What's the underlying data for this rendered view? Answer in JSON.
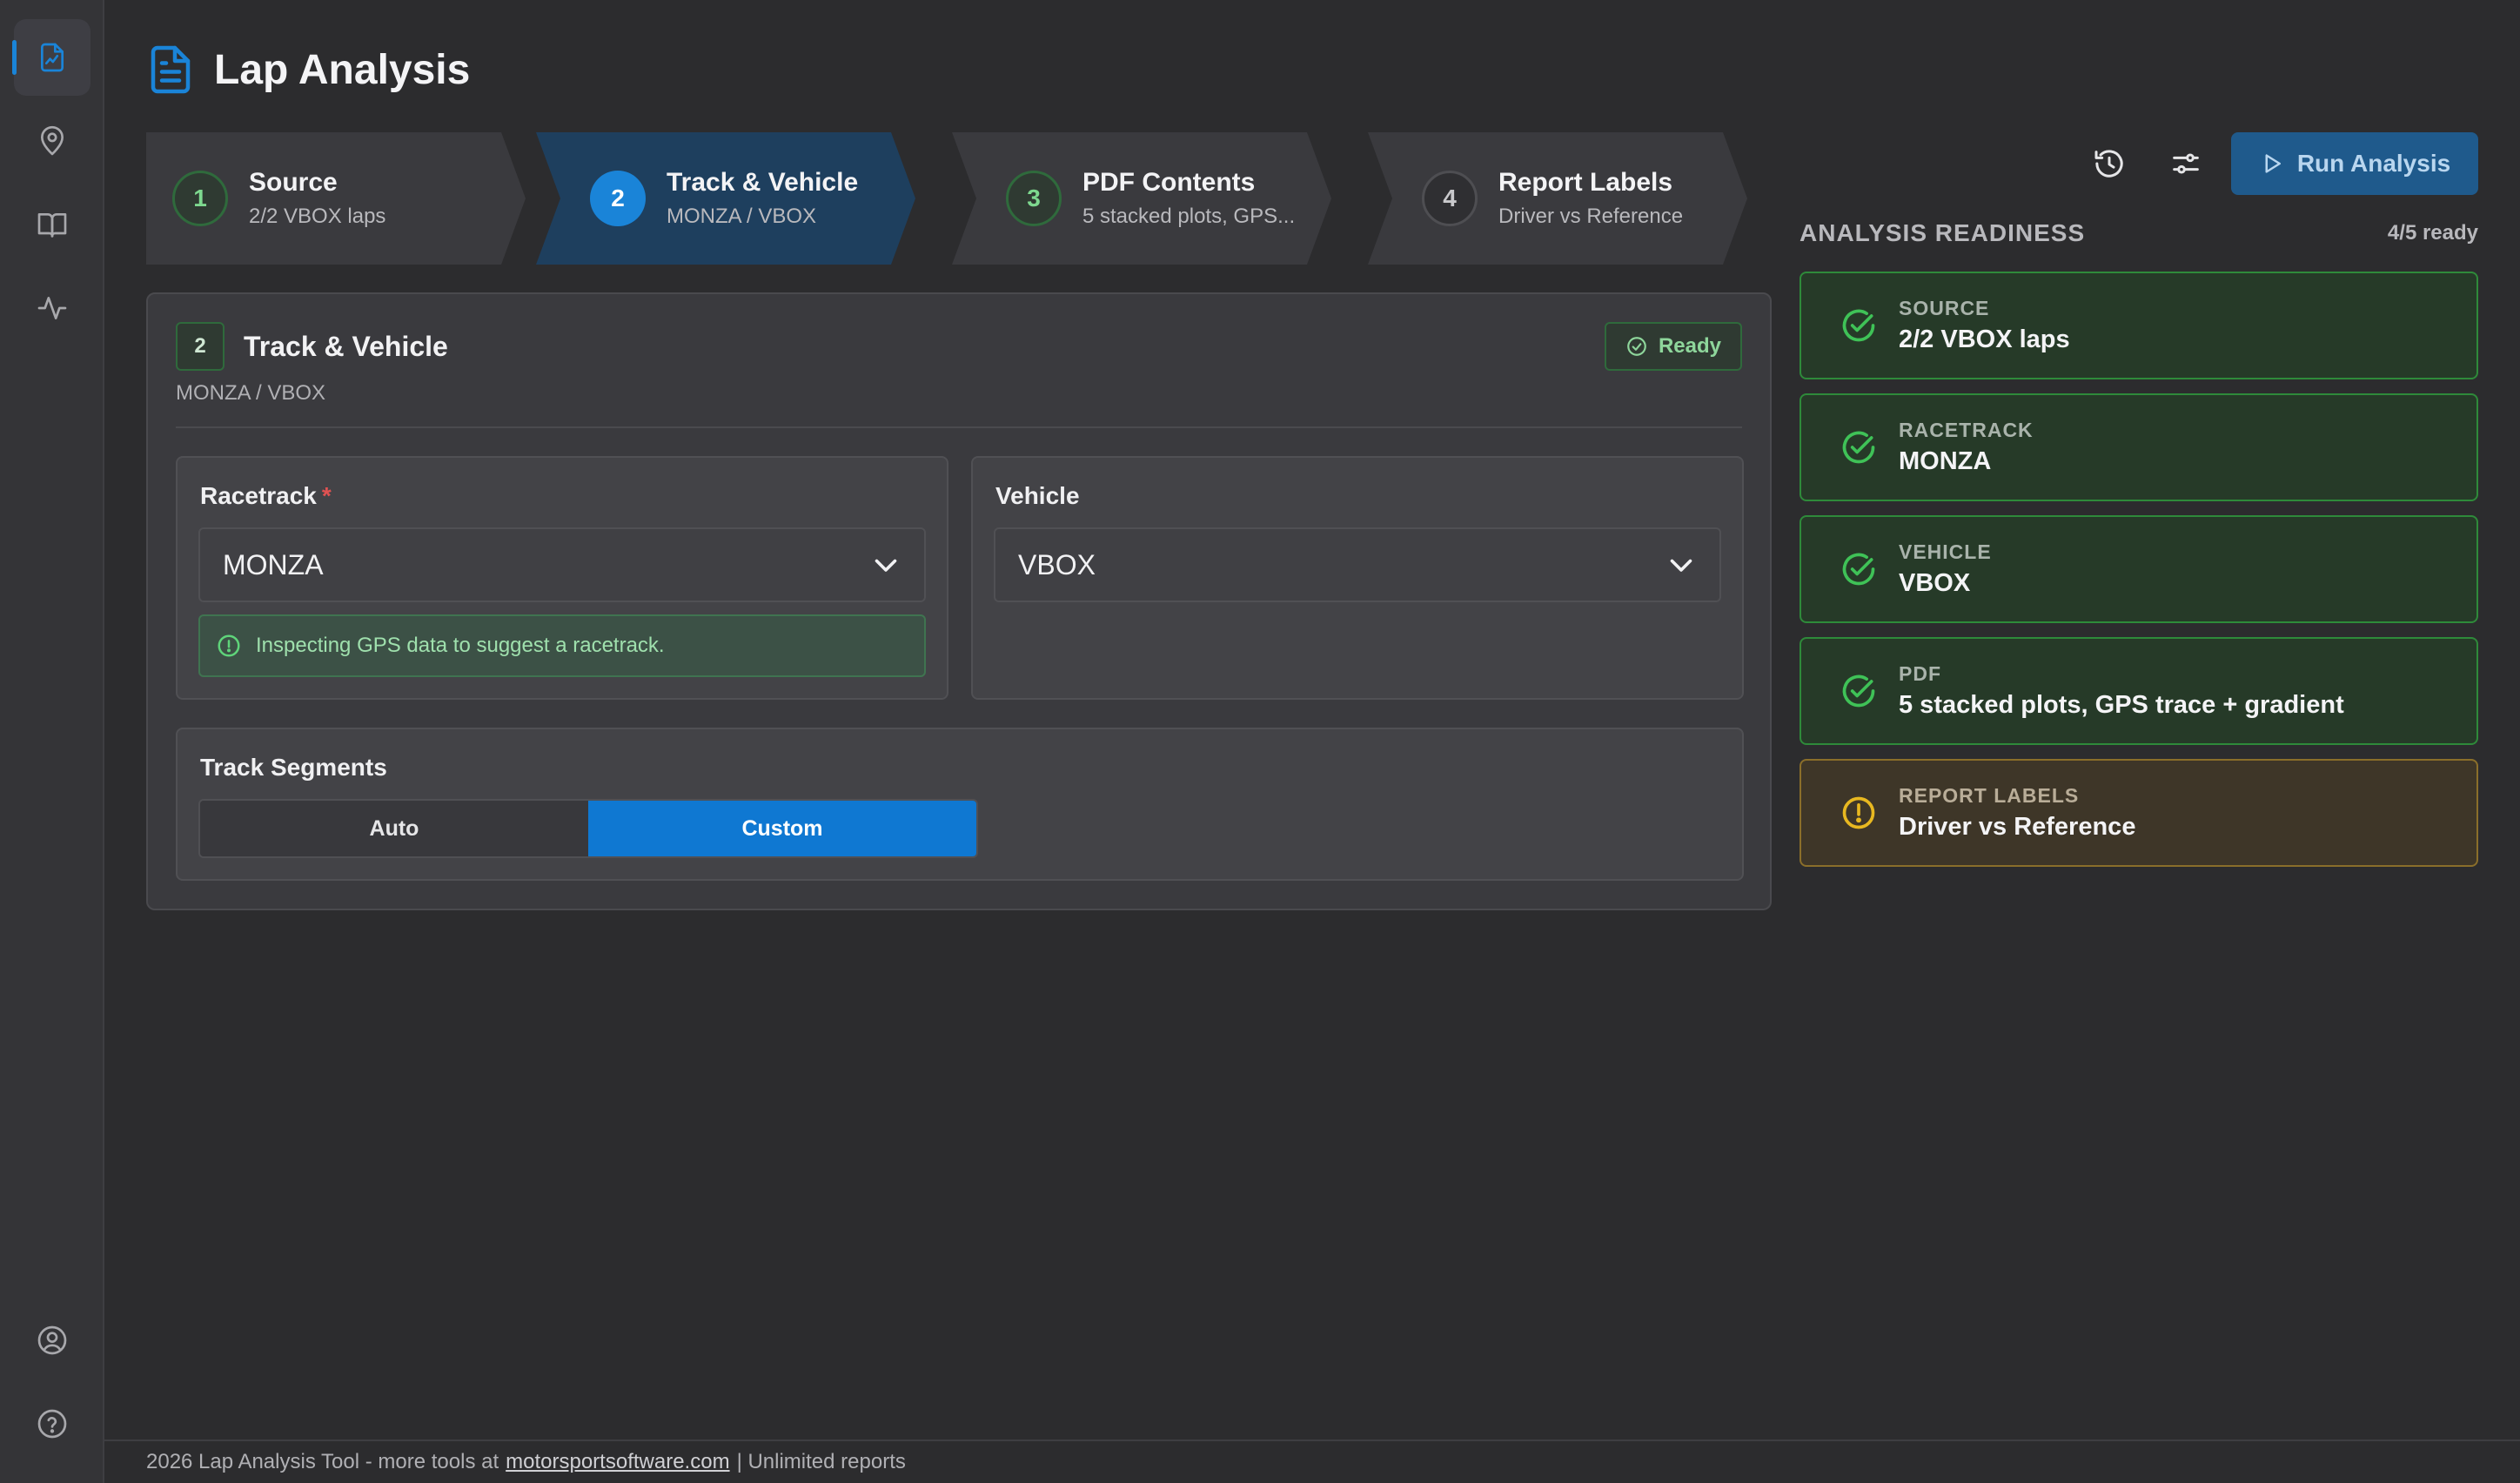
{
  "header": {
    "title": "Lap Analysis"
  },
  "sidebar": {
    "items": [
      {
        "name": "report",
        "icon": "file-chart-icon",
        "active": true
      },
      {
        "name": "tracks",
        "icon": "map-pin-icon"
      },
      {
        "name": "docs",
        "icon": "book-icon"
      },
      {
        "name": "telemetry",
        "icon": "activity-icon"
      }
    ],
    "bottom": [
      {
        "name": "account",
        "icon": "user-circle-icon"
      },
      {
        "name": "help",
        "icon": "help-circle-icon"
      }
    ]
  },
  "steps": [
    {
      "number": "1",
      "title": "Source",
      "subtitle": "2/2 VBOX laps",
      "state": "done"
    },
    {
      "number": "2",
      "title": "Track & Vehicle",
      "subtitle": "MONZA / VBOX",
      "state": "current"
    },
    {
      "number": "3",
      "title": "PDF Contents",
      "subtitle": "5 stacked plots, GPS...",
      "state": "done"
    },
    {
      "number": "4",
      "title": "Report Labels",
      "subtitle": "Driver vs Reference",
      "state": "pending"
    }
  ],
  "card": {
    "number": "2",
    "title": "Track & Vehicle",
    "subtitle": "MONZA / VBOX",
    "status": "Ready",
    "racetrack": {
      "label": "Racetrack",
      "required_mark": "*",
      "value": "MONZA",
      "hint": "Inspecting GPS data to suggest a racetrack."
    },
    "vehicle": {
      "label": "Vehicle",
      "value": "VBOX"
    },
    "segments": {
      "label": "Track Segments",
      "options": [
        "Auto",
        "Custom"
      ],
      "selected": "Custom"
    }
  },
  "toolbar": {
    "run_label": "Run Analysis"
  },
  "readiness": {
    "title": "ANALYSIS READINESS",
    "count": "4/5 ready",
    "items": [
      {
        "label": "SOURCE",
        "value": "2/2 VBOX laps",
        "status": "ok"
      },
      {
        "label": "RACETRACK",
        "value": "MONZA",
        "status": "ok"
      },
      {
        "label": "VEHICLE",
        "value": "VBOX",
        "status": "ok"
      },
      {
        "label": "PDF",
        "value": "5 stacked plots, GPS trace + gradient",
        "status": "ok"
      },
      {
        "label": "REPORT LABELS",
        "value": "Driver vs Reference",
        "status": "warn"
      }
    ]
  },
  "footer": {
    "prefix": "2026 Lap Analysis Tool - more tools at",
    "link": "motorsportsoftware.com",
    "suffix": "| Unlimited reports"
  },
  "colors": {
    "accent": "#1a84d8",
    "ok": "#2e8a3a",
    "warn": "#8a6e2a",
    "background": "#2c2c2e"
  }
}
